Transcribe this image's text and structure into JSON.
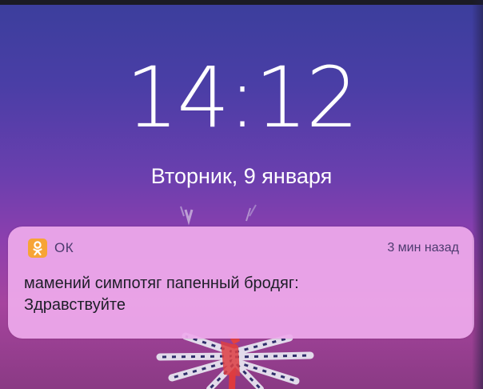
{
  "lock_screen": {
    "time": "14:12",
    "date": "Вторник, 9 января"
  },
  "notification": {
    "app_icon": "odnoklassniki-icon",
    "app_name": "ОК",
    "timestamp": "3 мин назад",
    "sender_line": "мамений симпотяг папенный бродяг:",
    "message": "Здравствуйте"
  },
  "colors": {
    "app_icon_bg": "#f7a436",
    "notification_bg": "#eeaaec",
    "wallpaper_top": "#3b3e9c",
    "wallpaper_bottom": "#a6449e"
  }
}
